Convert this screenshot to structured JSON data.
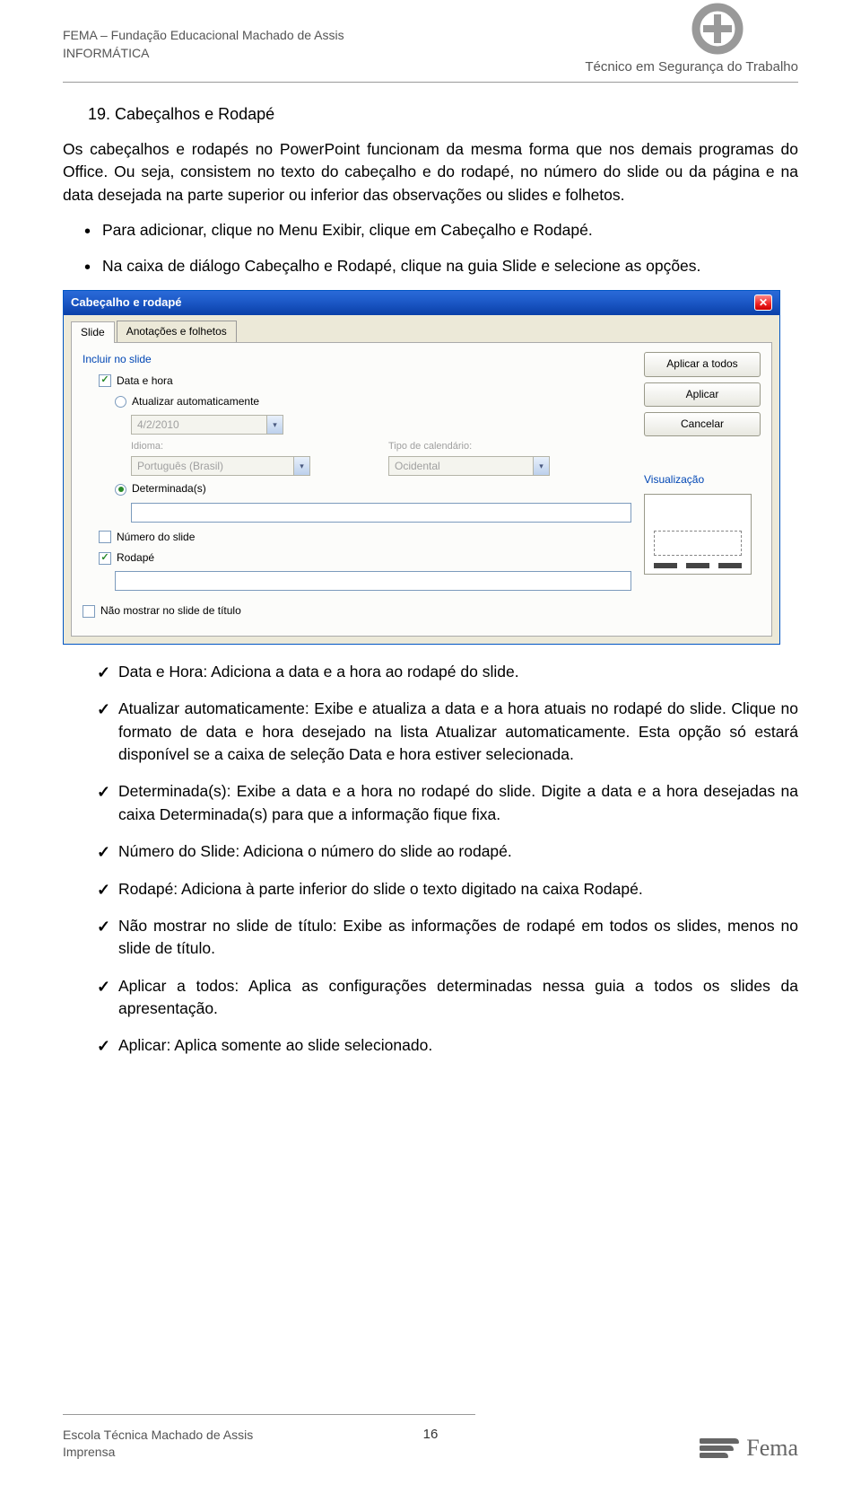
{
  "header": {
    "org_line1": "FEMA – Fundação Educacional Machado de Assis",
    "org_line2": "INFORMÁTICA",
    "course": "Técnico em Segurança do Trabalho"
  },
  "section": {
    "heading": "19. Cabeçalhos e Rodapé",
    "p1": "Os cabeçalhos e rodapés no PowerPoint funcionam da mesma forma que nos demais programas do Office. Ou seja, consistem no texto do cabeçalho e do rodapé, no número do slide ou da página e na data desejada na parte superior ou inferior das observações ou slides e folhetos.",
    "bullets": [
      "Para adicionar, clique no Menu Exibir, clique em Cabeçalho e Rodapé.",
      "Na caixa de diálogo Cabeçalho e Rodapé, clique na guia Slide e selecione as opções."
    ],
    "checks": [
      "Data e Hora: Adiciona a data e a hora ao rodapé do slide.",
      "Atualizar automaticamente: Exibe e atualiza a data e a hora atuais no rodapé do slide. Clique no formato de data e hora desejado na lista Atualizar automaticamente. Esta opção só estará disponível se a caixa de seleção Data e hora estiver selecionada.",
      "Determinada(s): Exibe a data e a hora no rodapé do slide. Digite a data e a hora desejadas na caixa Determinada(s) para que a informação fique fixa.",
      "Número do Slide: Adiciona o número do slide ao rodapé.",
      "Rodapé: Adiciona à parte inferior do slide o texto digitado na caixa Rodapé.",
      "Não mostrar no slide de título: Exibe as informações de rodapé em todos os slides, menos no slide de título.",
      "Aplicar a todos: Aplica as configurações determinadas nessa guia a todos os slides da apresentação.",
      "Aplicar: Aplica somente ao slide selecionado."
    ]
  },
  "dialog": {
    "title": "Cabeçalho e rodapé",
    "tabs": [
      "Slide",
      "Anotações e folhetos"
    ],
    "group_include": "Incluir no slide",
    "chk_date": "Data e hora",
    "rad_auto": "Atualizar automaticamente",
    "date_value": "4/2/2010",
    "lbl_idioma": "Idioma:",
    "val_idioma": "Português (Brasil)",
    "lbl_caltype": "Tipo de calendário:",
    "val_caltype": "Ocidental",
    "rad_fixed": "Determinada(s)",
    "chk_slidenum": "Número do slide",
    "chk_footer": "Rodapé",
    "chk_noshow": "Não mostrar no slide de título",
    "btn_applyall": "Aplicar a todos",
    "btn_apply": "Aplicar",
    "btn_cancel": "Cancelar",
    "group_preview": "Visualização"
  },
  "footer": {
    "line1": "Escola Técnica Machado de Assis",
    "line2": "Imprensa",
    "page": "16",
    "logo_text": "Fema"
  }
}
